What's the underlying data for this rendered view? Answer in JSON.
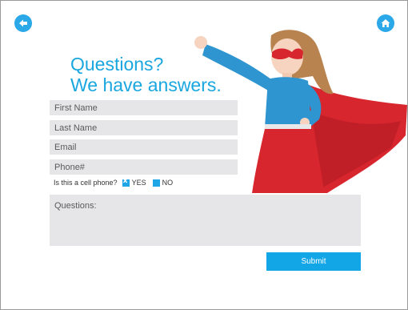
{
  "header": {
    "back_icon": "arrow-left-icon",
    "home_icon": "home-icon",
    "accent_color": "#1aa6df"
  },
  "headline": {
    "line1": "Questions?",
    "line2": "We have answers."
  },
  "form": {
    "first_name": {
      "placeholder": "First Name",
      "value": ""
    },
    "last_name": {
      "placeholder": "Last Name",
      "value": ""
    },
    "email": {
      "placeholder": "Email",
      "value": ""
    },
    "phone": {
      "placeholder": "Phone#",
      "value": ""
    },
    "cell_phone": {
      "question": "Is this a cell phone?",
      "yes_label": "YES",
      "no_label": "NO",
      "selected": "YES"
    },
    "questions": {
      "placeholder": "Questions:",
      "value": ""
    },
    "submit_label": "Submit"
  },
  "hero_image": {
    "subject": "girl-superhero",
    "cape_color": "#d8262e",
    "shirt_color": "#2f95d0"
  }
}
